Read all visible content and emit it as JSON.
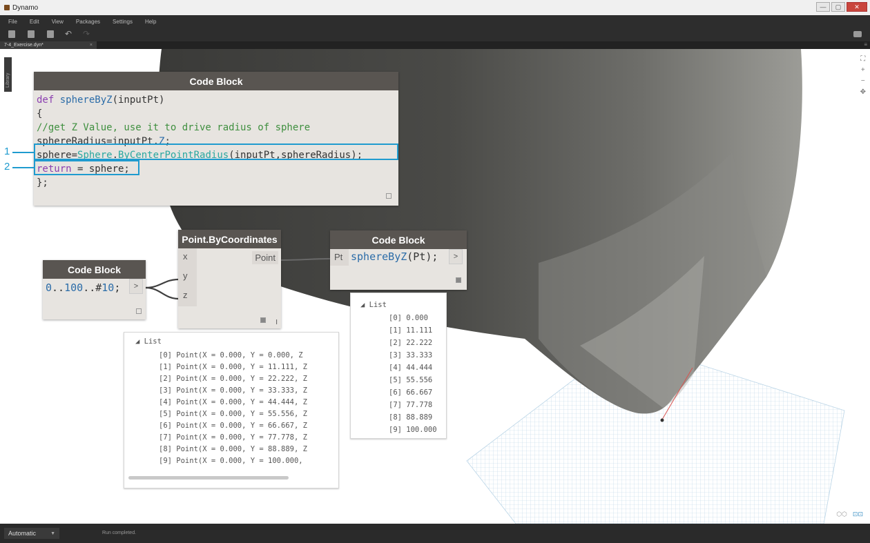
{
  "window": {
    "title": "Dynamo",
    "controls": [
      "—",
      "▢",
      "✕"
    ]
  },
  "menu": [
    "File",
    "Edit",
    "View",
    "Packages",
    "Settings",
    "Help"
  ],
  "tab": {
    "label": "7-4_Exercise.dyn*",
    "close": "×",
    "menu": "≡"
  },
  "library_label": "Library",
  "nav": {
    "fit": "⛶",
    "zoom_in": "+",
    "zoom_out": "−",
    "pan": "✥"
  },
  "view_toggle": {
    "geometry": "⬡⬡",
    "graph": "⊡⊡"
  },
  "code_block_main": {
    "title": "Code Block",
    "lines": [
      {
        "a": "def ",
        "b": "sphereByZ",
        "c": "(inputPt)"
      },
      {
        "a": "{"
      },
      {
        "a": "//get Z Value, use it to drive radius of sphere"
      },
      {
        "a": "sphereRadius=inputPt.",
        "b": "Z",
        "c": ";"
      },
      {
        "a": "sphere=",
        "b": "Sphere",
        "c": ".",
        "d": "ByCenterPointRadius",
        "e": "(inputPt,sphereRadius);"
      },
      {
        "a": "return",
        "b": " = sphere;"
      },
      {
        "a": "};"
      }
    ]
  },
  "callouts": [
    "1",
    "2"
  ],
  "code_block_small": {
    "title": "Code Block",
    "start": "0",
    "sep1": "..",
    "end": "100",
    "sep2": "..#",
    "count": "10",
    "tail": ";",
    "out": ">"
  },
  "point_node": {
    "title": "Point.ByCoordinates",
    "inputs": [
      "x",
      "y",
      "z"
    ],
    "output": "Point",
    "lacing": "I"
  },
  "code_block_fn": {
    "title": "Code Block",
    "input": "Pt",
    "fn": "sphereByZ",
    "args": "(Pt);",
    "out": ">"
  },
  "point_list": {
    "header": "◢ List",
    "items": [
      "[0] Point(X = 0.000, Y = 0.000, Z",
      "[1] Point(X = 0.000, Y = 11.111, Z",
      "[2] Point(X = 0.000, Y = 22.222, Z",
      "[3] Point(X = 0.000, Y = 33.333, Z",
      "[4] Point(X = 0.000, Y = 44.444, Z",
      "[5] Point(X = 0.000, Y = 55.556, Z",
      "[6] Point(X = 0.000, Y = 66.667, Z",
      "[7] Point(X = 0.000, Y = 77.778, Z",
      "[8] Point(X = 0.000, Y = 88.889, Z",
      "[9] Point(X = 0.000, Y = 100.000,"
    ]
  },
  "sphere_list": {
    "header": "◢ List",
    "items": [
      "[0] 0.000",
      "[1] 11.111",
      "[2] 22.222",
      "[3] 33.333",
      "[4] 44.444",
      "[5] 55.556",
      "[6] 66.667",
      "[7] 77.778",
      "[8] 88.889",
      "[9] 100.000"
    ]
  },
  "status": {
    "run_mode": "Automatic",
    "message": "Run completed."
  }
}
